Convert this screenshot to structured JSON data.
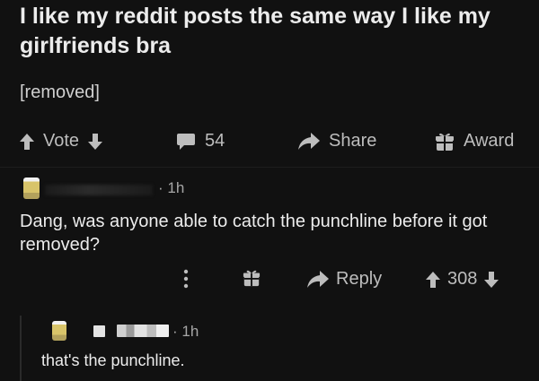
{
  "post": {
    "title": "I like my reddit posts the same way I like my girlfriends bra",
    "body": "[removed]"
  },
  "post_actions": {
    "vote_label": "Vote",
    "comment_count": "54",
    "share_label": "Share",
    "award_label": "Award"
  },
  "comment": {
    "time": "· 1h",
    "text": "Dang, was anyone able to catch the punchline before it got removed?",
    "reply_label": "Reply",
    "score": "308"
  },
  "reply": {
    "time": "· 1h",
    "text": "that's the punchline."
  },
  "colors": {
    "background": "#111111",
    "text": "#ececec",
    "muted": "#bdbdbd"
  }
}
